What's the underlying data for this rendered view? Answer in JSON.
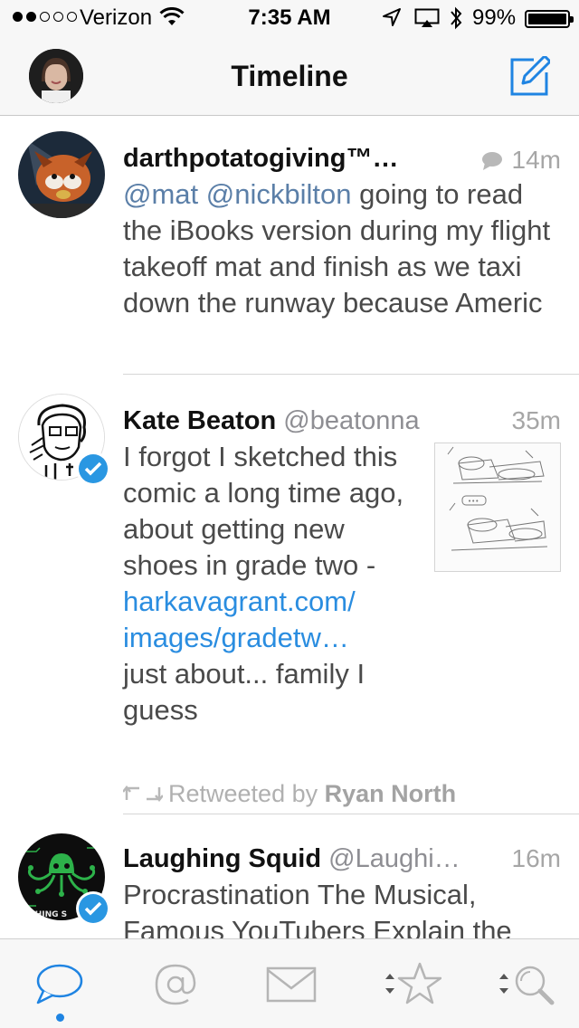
{
  "status_bar": {
    "carrier": "Verizon",
    "time": "7:35 AM",
    "battery": "99%",
    "signal_bars": 2,
    "signal_total": 5
  },
  "nav": {
    "title": "Timeline"
  },
  "tweets": [
    {
      "name": "darthpotatogiving™…",
      "handle": "",
      "time": "14m",
      "has_reply_icon": true,
      "mention1": "@mat",
      "mention2": "@nickbilton",
      "text_line1": " going to read",
      "text_rest": "the iBooks version during my flight takeoff mat and finish as we taxi down the runway because Americ"
    },
    {
      "name": "Kate Beaton",
      "handle": "@beatonna",
      "time": "35m",
      "verified": true,
      "text_before": "I forgot I sketched this comic a long time ago, about getting new shoes in grade two -",
      "link_line1": "harkavagrant.com/",
      "link_line2": "images/gradetw…",
      "text_after": "just about... family I guess",
      "retweet_prefix": "Retweeted by ",
      "retweeted_by": "Ryan North"
    },
    {
      "name": "Laughing Squid",
      "handle": "@Laughi…",
      "time": "16m",
      "verified": true,
      "text": "Procrastination The Musical, Famous YouTubers Explain the"
    }
  ],
  "tab_bar": {
    "tabs": [
      "timeline-icon",
      "mentions-icon",
      "messages-icon",
      "favorites-icon",
      "search-icon"
    ],
    "selected": 0,
    "accent": "#1f84e2",
    "inactive": "#b5b5b5"
  }
}
